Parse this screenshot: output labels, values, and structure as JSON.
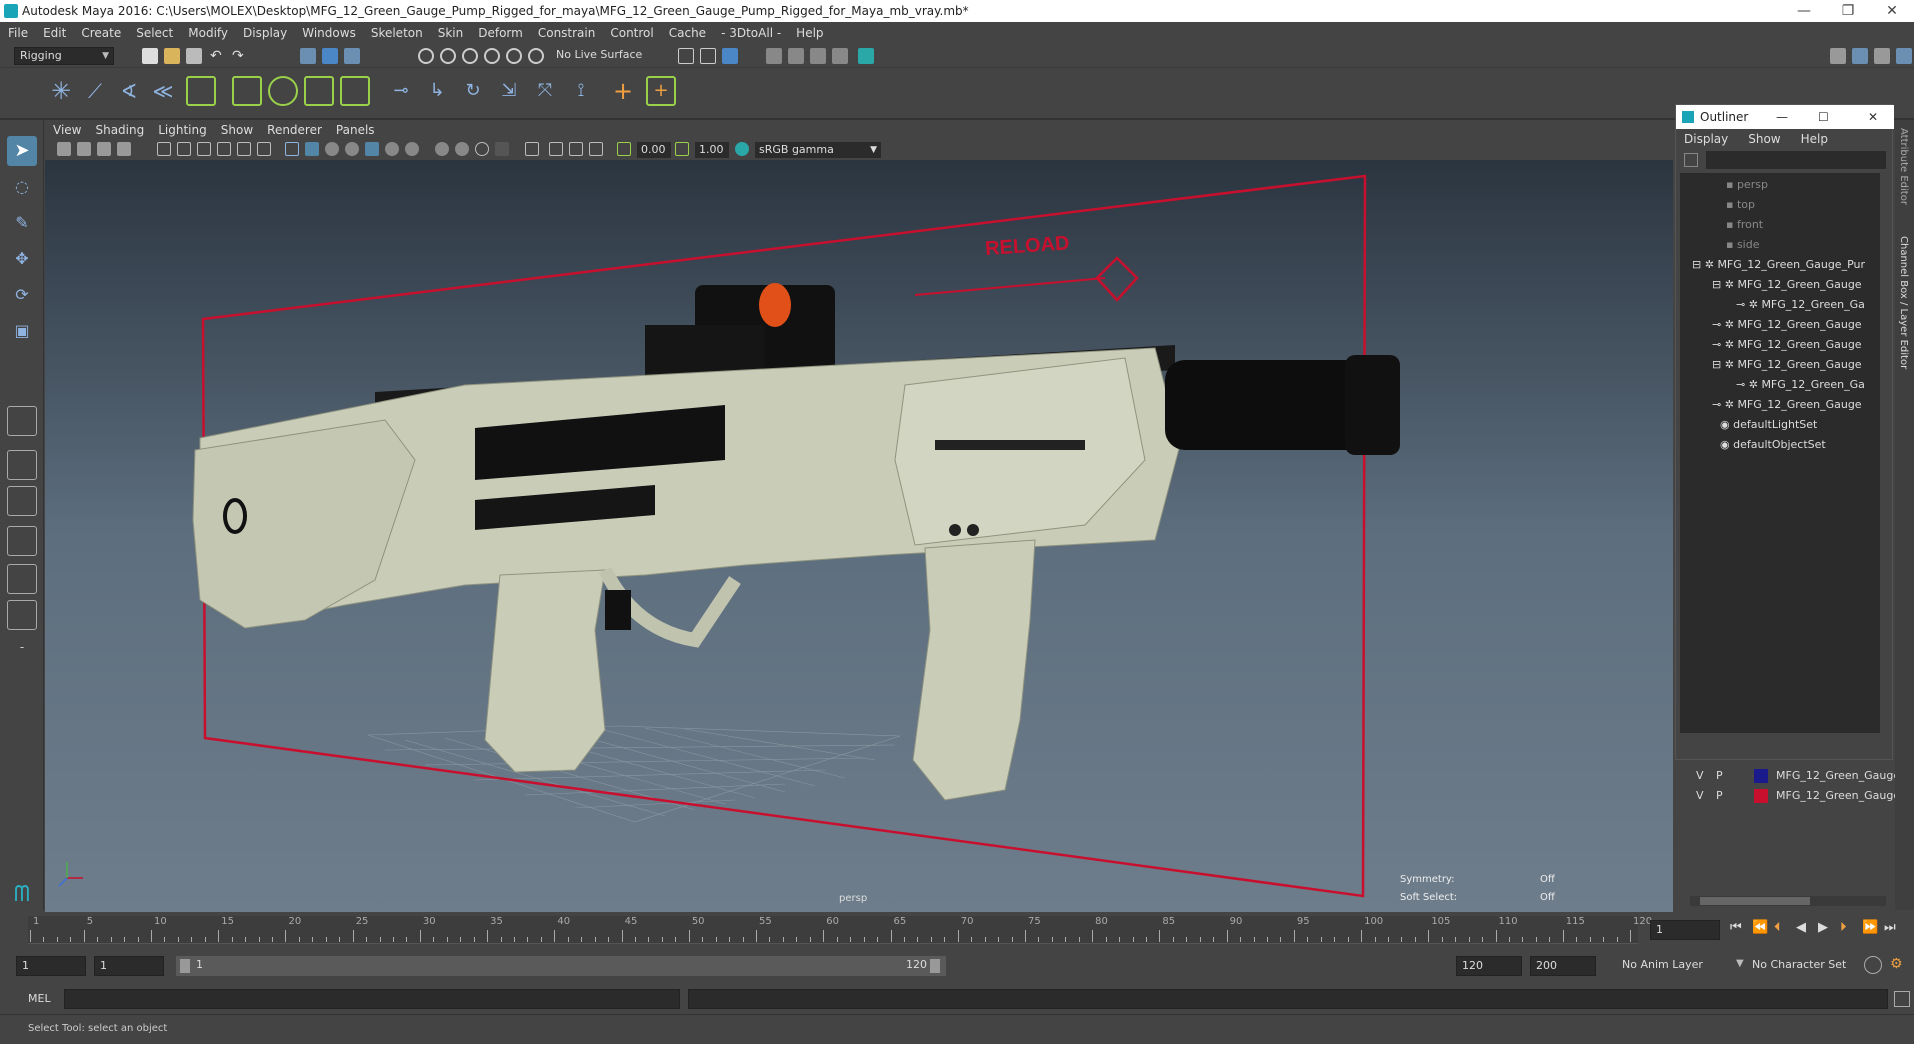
{
  "window": {
    "title": "Autodesk Maya 2016: C:\\Users\\MOLEX\\Desktop\\MFG_12_Green_Gauge_Pump_Rigged_for_maya\\MFG_12_Green_Gauge_Pump_Rigged_for_Maya_mb_vray.mb*",
    "minimize": "—",
    "restore": "❐",
    "close": "✕"
  },
  "menubar": [
    "File",
    "Edit",
    "Create",
    "Select",
    "Modify",
    "Display",
    "Windows",
    "Skeleton",
    "Skin",
    "Deform",
    "Constrain",
    "Control",
    "Cache",
    "- 3DtoAll -",
    "Help"
  ],
  "statusline": {
    "menuset": "Rigging",
    "live_surface": "No Live Surface"
  },
  "panel": {
    "menus": [
      "View",
      "Shading",
      "Lighting",
      "Show",
      "Renderer",
      "Panels"
    ],
    "near_value": "0.00",
    "far_value": "1.00",
    "color_space": "sRGB gamma"
  },
  "viewport": {
    "camera_label": "persp",
    "hud_symmetry_label": "Symmetry:",
    "hud_symmetry_value": "Off",
    "hud_soft_select_label": "Soft Select:",
    "hud_soft_select_value": "Off",
    "reload_text": "RELOAD",
    "frame_color": "#c8102e",
    "gun_color": "#c9cdb8"
  },
  "outliner": {
    "title": "Outliner",
    "menus": [
      "Display",
      "Show",
      "Help"
    ],
    "items": [
      {
        "label": "persp",
        "dim": true
      },
      {
        "label": "top",
        "dim": true
      },
      {
        "label": "front",
        "dim": true
      },
      {
        "label": "side",
        "dim": true
      },
      {
        "label": "MFG_12_Green_Gauge_Pur",
        "dim": false
      },
      {
        "label": "MFG_12_Green_Gauge",
        "dim": false
      },
      {
        "label": "MFG_12_Green_Ga",
        "dim": false
      },
      {
        "label": "MFG_12_Green_Gauge",
        "dim": false
      },
      {
        "label": "MFG_12_Green_Gauge",
        "dim": false
      },
      {
        "label": "MFG_12_Green_Gauge",
        "dim": false
      },
      {
        "label": "MFG_12_Green_Ga",
        "dim": false
      },
      {
        "label": "MFG_12_Green_Gauge",
        "dim": false
      },
      {
        "label": "defaultLightSet",
        "dim": false
      },
      {
        "label": "defaultObjectSet",
        "dim": false
      }
    ]
  },
  "layers": [
    {
      "v": "V",
      "p": "P",
      "color": "#1a1a8c",
      "name": "MFG_12_Green_Gauge"
    },
    {
      "v": "V",
      "p": "P",
      "color": "#c8102e",
      "name": "MFG_12_Green_Gauge"
    }
  ],
  "sidetabs": {
    "attribute_editor": "Attribute Editor",
    "channel_box": "Channel Box / Layer Editor"
  },
  "timeslider": {
    "labels": [
      "1",
      "5",
      "10",
      "15",
      "20",
      "25",
      "30",
      "35",
      "40",
      "45",
      "50",
      "55",
      "60",
      "65",
      "70",
      "75",
      "80",
      "85",
      "90",
      "95",
      "100",
      "105",
      "110",
      "115",
      "120"
    ],
    "current_frame": "1"
  },
  "range": {
    "start": "1",
    "playback_start": "1",
    "slider_start": "1",
    "slider_end": "120",
    "playback_end": "120",
    "end": "200",
    "anim_layer": "No Anim Layer",
    "character_set": "No Character Set"
  },
  "cmdline": {
    "label": "MEL"
  },
  "helpline": {
    "text": "Select Tool: select an object"
  }
}
